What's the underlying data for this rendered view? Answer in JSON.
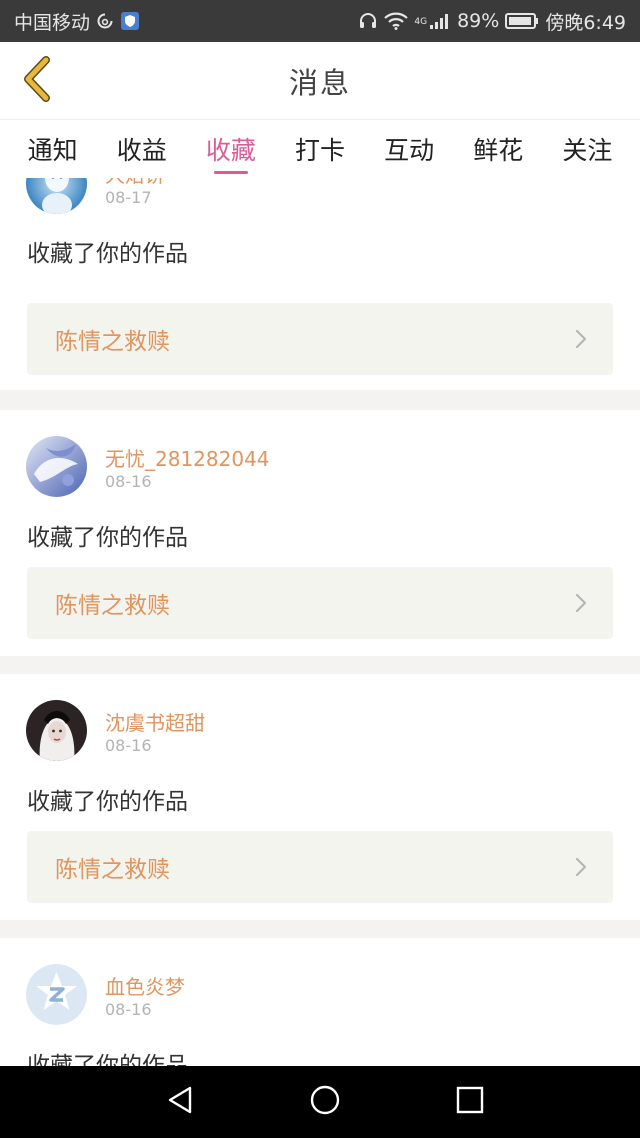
{
  "status_bar": {
    "carrier": "中国移动",
    "network_type": "4G",
    "battery": "89%",
    "time": "傍晚6:49",
    "icons": [
      "sync-icon",
      "shield-app-icon",
      "headset-icon",
      "wifi-icon",
      "signal-icon",
      "battery-icon"
    ]
  },
  "header": {
    "title": "消息",
    "back_icon": "chevron-left-icon"
  },
  "tabs": [
    {
      "label": "通知",
      "active": false
    },
    {
      "label": "收益",
      "active": false
    },
    {
      "label": "收藏",
      "active": true
    },
    {
      "label": "打卡",
      "active": false
    },
    {
      "label": "互动",
      "active": false
    },
    {
      "label": "鲜花",
      "active": false
    },
    {
      "label": "关注",
      "active": false
    }
  ],
  "messages": [
    {
      "username": "大烙饼",
      "date": "08-17",
      "action": "收藏了你的作品",
      "work_title": "陈情之救赎"
    },
    {
      "username": "无忧_281282044",
      "date": "08-16",
      "action": "收藏了你的作品",
      "work_title": "陈情之救赎"
    },
    {
      "username": "沈虞书超甜",
      "date": "08-16",
      "action": "收藏了你的作品",
      "work_title": "陈情之救赎"
    },
    {
      "username": "血色炎梦",
      "date": "08-16",
      "action": "收藏了你的作品"
    }
  ],
  "colors": {
    "accent": "#d85d98",
    "username": "#e0955e",
    "back_icon": "#e8b73c",
    "work_box": "#f4f4ef",
    "status_bar": "#3a3a3a",
    "nav_bar": "#000000"
  },
  "nav_bar": {
    "icons": [
      "back-triangle-icon",
      "home-circle-icon",
      "recents-square-icon"
    ]
  }
}
